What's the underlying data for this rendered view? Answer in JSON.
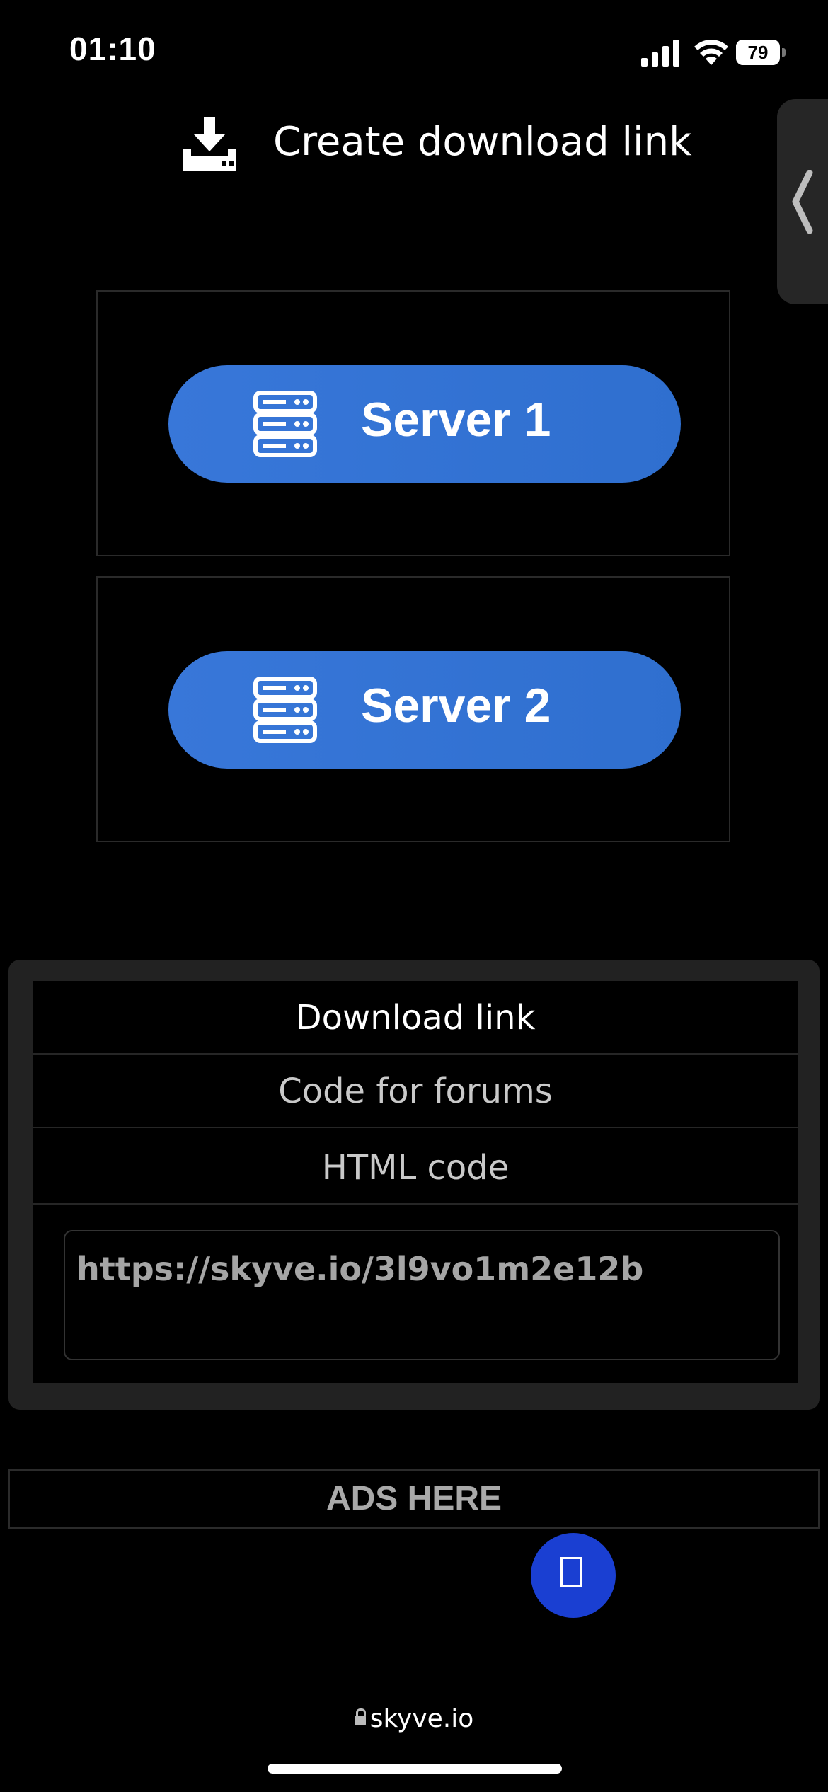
{
  "status_bar": {
    "time": "01:10",
    "battery": "79",
    "battery_level": 0.79
  },
  "header": {
    "title": "Create download link",
    "icon": "download-icon"
  },
  "servers": [
    {
      "label": "Server 1",
      "icon": "server-icon"
    },
    {
      "label": "Server 2",
      "icon": "server-icon"
    }
  ],
  "link_panel": {
    "tabs": [
      {
        "label": "Download link",
        "active": true
      },
      {
        "label": "Code for forums",
        "active": false
      },
      {
        "label": "HTML code",
        "active": false
      }
    ],
    "link_value": "https://skyve.io/3l9vo1m2e12b"
  },
  "ads": {
    "label": "ADS HERE"
  },
  "browser": {
    "domain": "skyve.io"
  },
  "colors": {
    "button_blue": "#3877d9",
    "fab_blue": "#1a3fd2",
    "background": "#000000",
    "panel": "#222222"
  }
}
